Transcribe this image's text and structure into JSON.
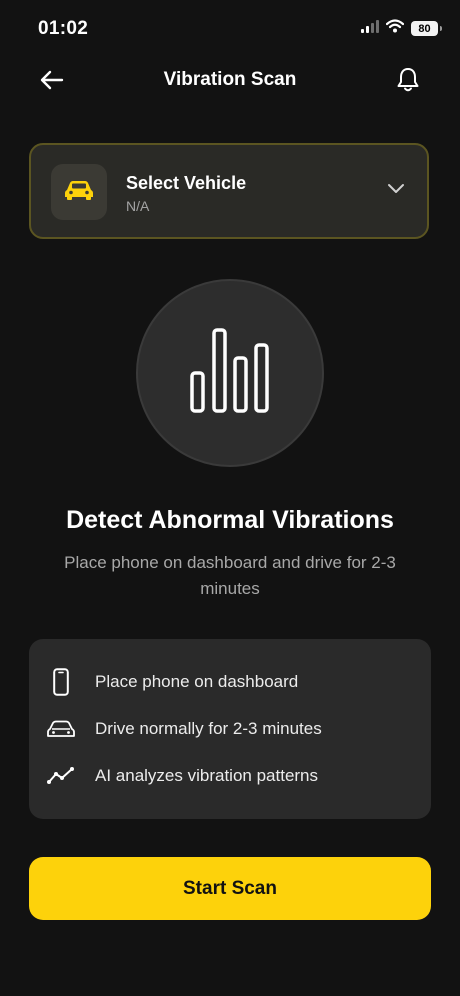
{
  "status_bar": {
    "time": "01:02",
    "battery": "80",
    "icons": [
      "cellular-signal-icon",
      "wifi-icon",
      "battery-icon"
    ]
  },
  "header": {
    "title": "Vibration Scan",
    "back_icon": "arrow-left-icon",
    "bell_icon": "bell-icon"
  },
  "vehicle": {
    "title": "Select Vehicle",
    "value": "N/A",
    "icon": "car-icon",
    "chevron_icon": "chevron-down-icon"
  },
  "hero": {
    "icon": "signal-bars-icon",
    "title": "Detect Abnormal Vibrations",
    "subtitle": "Place phone on dashboard and drive for 2-3 minutes"
  },
  "steps": [
    {
      "icon": "phone-icon",
      "label": "Place phone on dashboard"
    },
    {
      "icon": "car-outline-icon",
      "label": "Drive normally for 2-3 minutes"
    },
    {
      "icon": "trend-line-icon",
      "label": "AI analyzes vibration patterns"
    }
  ],
  "cta": {
    "label": "Start Scan"
  },
  "colors": {
    "background": "#121212",
    "accent": "#fdd20b",
    "card": "#2a2a2a",
    "muted_text": "#a8a8a8"
  }
}
